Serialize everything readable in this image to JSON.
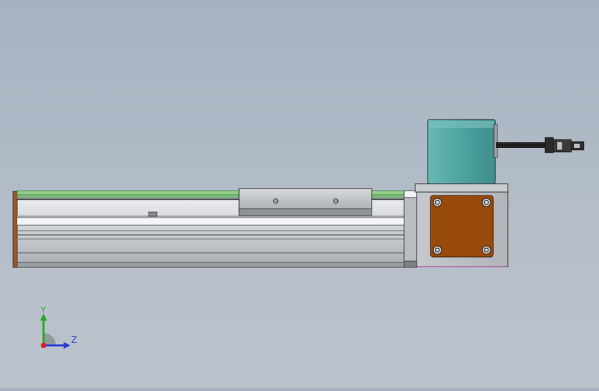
{
  "viewport": {
    "background_top": "#a6b2c1",
    "background_bottom": "#bcc3cc"
  },
  "model": {
    "rail_color": "#c7c9cc",
    "guide_strip_color": "#8fcf8a",
    "end_cap_color": "#9a5a2e",
    "carriage_color": "#bfc1c4",
    "motor_body_color": "#4ea3a0",
    "motor_flange_color": "#984a0a",
    "cable_color": "#1a1a1a"
  },
  "triad": {
    "y_label": "Y",
    "z_label": "Z",
    "y_color": "#22aa22",
    "z_color": "#2b3bd0",
    "origin_color": "#e02020",
    "arc_color": "#8e9196"
  }
}
